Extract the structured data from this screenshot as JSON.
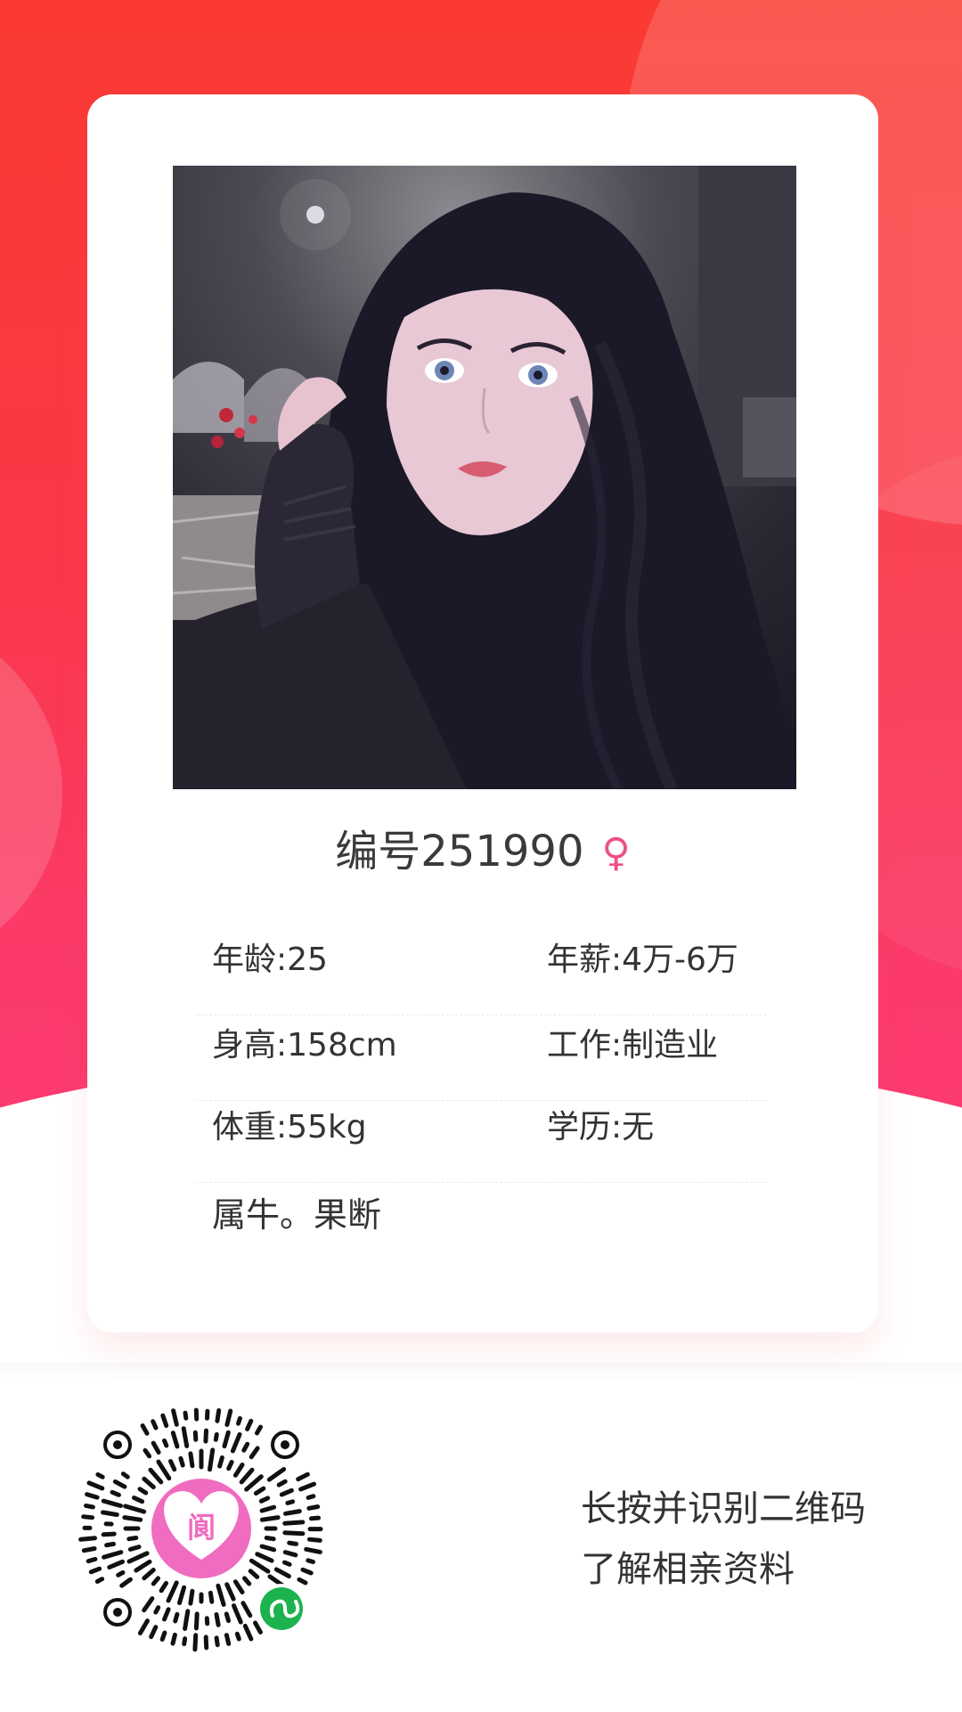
{
  "profile": {
    "id_text": "编号251990",
    "gender_symbol": "♀",
    "info_rows": [
      {
        "left": "年龄:25",
        "right": "年薪:4万-6万"
      },
      {
        "left": "身高:158cm",
        "right": "工作:制造业"
      },
      {
        "left": "体重:55kg",
        "right": "学历:无"
      }
    ],
    "description": "属牛。果断"
  },
  "qr": {
    "logo_char": "阆"
  },
  "hint": {
    "line1": "长按并识别二维码",
    "line2": "了解相亲资料"
  },
  "colors": {
    "accent_red": "#fa3a32",
    "accent_pink": "#fd3c7a",
    "gender_pink": "#ee4f86",
    "logo_pink": "#f06cc0",
    "mini_program_green": "#1cb34f"
  }
}
